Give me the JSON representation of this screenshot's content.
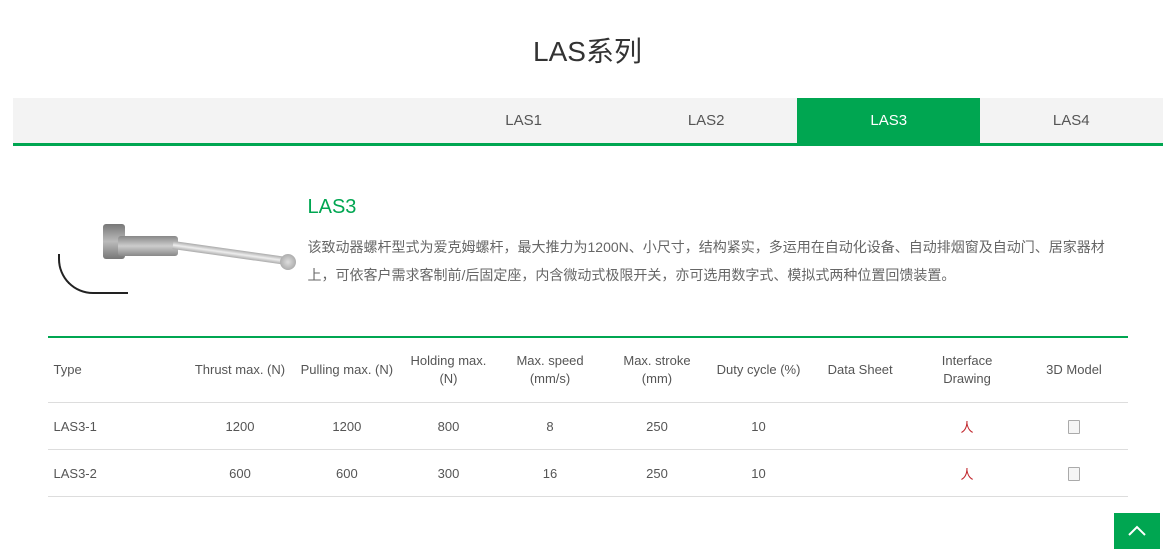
{
  "title": "LAS系列",
  "tabs": [
    {
      "label": "LAS1",
      "active": false
    },
    {
      "label": "LAS2",
      "active": false
    },
    {
      "label": "LAS3",
      "active": true
    },
    {
      "label": "LAS4",
      "active": false
    }
  ],
  "product": {
    "name": "LAS3",
    "description": "该致动器螺杆型式为爱克姆螺杆，最大推力为1200N、小尺寸，结构紧实，多运用在自动化设备、自动排烟窗及自动门、居家器材上，可依客户需求客制前/后固定座，内含微动式极限开关，亦可选用数字式、模拟式两种位置回馈装置。"
  },
  "table": {
    "headers": {
      "type": "Type",
      "thrust": "Thrust max. (N)",
      "pulling": "Pulling max. (N)",
      "holding": "Holding max. (N)",
      "speed": "Max. speed (mm/s)",
      "stroke": "Max. stroke (mm)",
      "duty": "Duty cycle (%)",
      "datasheet": "Data Sheet",
      "interface": "Interface Drawing",
      "model3d": "3D Model"
    },
    "rows": [
      {
        "type": "LAS3-1",
        "thrust": "1200",
        "pulling": "1200",
        "holding": "800",
        "speed": "8",
        "stroke": "250",
        "duty": "10",
        "datasheet": "",
        "interface": "pdf",
        "model3d": "file"
      },
      {
        "type": "LAS3-2",
        "thrust": "600",
        "pulling": "600",
        "holding": "300",
        "speed": "16",
        "stroke": "250",
        "duty": "10",
        "datasheet": "",
        "interface": "pdf",
        "model3d": "file"
      }
    ]
  }
}
